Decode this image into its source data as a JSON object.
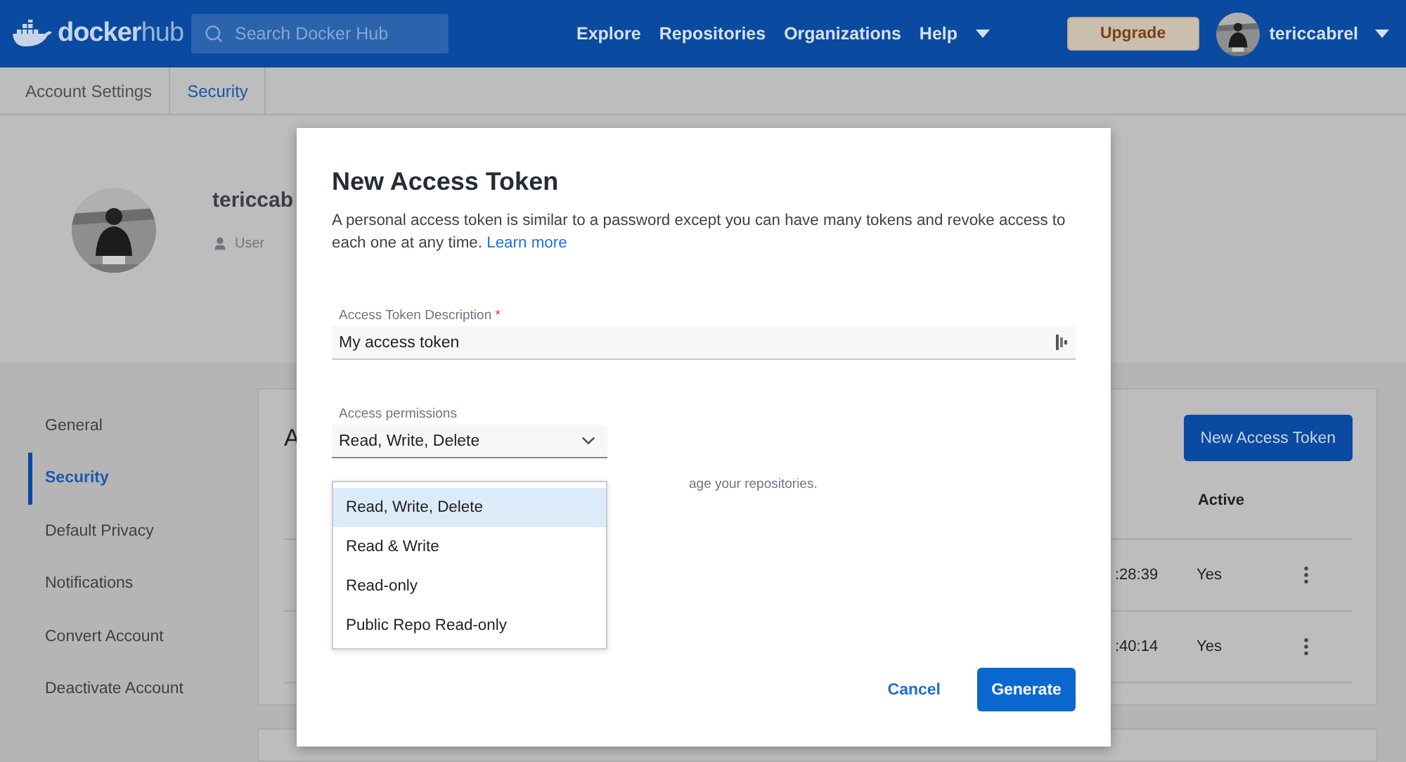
{
  "header": {
    "logo": {
      "primary": "docker",
      "secondary": "hub"
    },
    "search": {
      "placeholder": "Search Docker Hub"
    },
    "nav": [
      "Explore",
      "Repositories",
      "Organizations",
      "Help"
    ],
    "upgrade": "Upgrade",
    "user": "tericcabrel"
  },
  "breadcrumb": [
    {
      "label": "Account Settings",
      "selected": false
    },
    {
      "label": "Security",
      "selected": true
    }
  ],
  "profile": {
    "name": "tericcab",
    "role": "User"
  },
  "sidebar": {
    "items": [
      {
        "label": "General",
        "selected": false
      },
      {
        "label": "Security",
        "selected": true
      },
      {
        "label": "Default Privacy",
        "selected": false
      },
      {
        "label": "Notifications",
        "selected": false
      },
      {
        "label": "Convert Account",
        "selected": false
      },
      {
        "label": "Deactivate Account",
        "selected": false
      }
    ]
  },
  "card": {
    "title": "A",
    "button": "New Access Token",
    "columns": [
      "Active"
    ],
    "rows": [
      {
        "time": ":28:39",
        "active": "Yes"
      },
      {
        "time": ":40:14",
        "active": "Yes"
      }
    ]
  },
  "dialog": {
    "title": "New Access Token",
    "description": "A personal access token is similar to a password except you can have many tokens and revoke access to each one at any time.",
    "link": "Learn more",
    "description_field": {
      "label": "Access Token Description",
      "required_mark": "*",
      "value": "My access token"
    },
    "permissions": {
      "label": "Access permissions",
      "value": "Read, Write, Delete",
      "expanded": true,
      "hint": "age your repositories.",
      "options": [
        {
          "label": "Read, Write, Delete",
          "selected": true
        },
        {
          "label": "Read & Write",
          "selected": false
        },
        {
          "label": "Read-only",
          "selected": false
        },
        {
          "label": "Public Repo Read-only",
          "selected": false
        }
      ]
    },
    "buttons": {
      "cancel": "Cancel",
      "generate": "Generate"
    }
  }
}
